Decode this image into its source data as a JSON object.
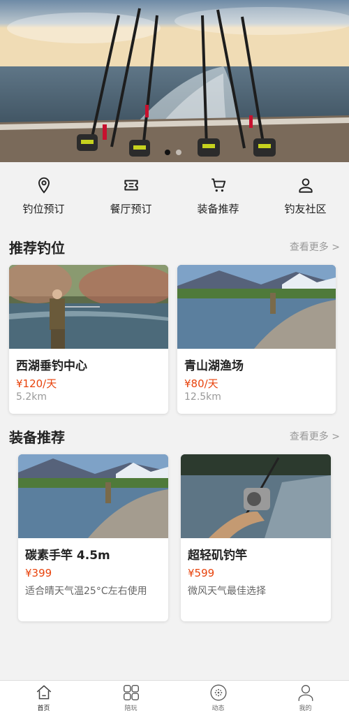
{
  "banner": {
    "image_alt": "fishing-boat-rods-photo",
    "slide_count": 2,
    "active_slide": 1
  },
  "quicknav": [
    {
      "label": "钓位预订",
      "icon": "location-pin-icon"
    },
    {
      "label": "餐厅预订",
      "icon": "ticket-icon"
    },
    {
      "label": "装备推荐",
      "icon": "cart-icon"
    },
    {
      "label": "钓友社区",
      "icon": "user-icon"
    }
  ],
  "spots": {
    "title": "推荐钓位",
    "more": "查看更多 >",
    "items": [
      {
        "name": "西湖垂钓中心",
        "price": "¥120/天",
        "distance": "5.2km"
      },
      {
        "name": "青山湖渔场",
        "price": "¥80/天",
        "distance": "12.5km"
      }
    ]
  },
  "gear": {
    "title": "装备推荐",
    "more": "查看更多 >",
    "items": [
      {
        "name": "碳素手竿 4.5m",
        "price": "¥399",
        "desc": "适合晴天气温25°C左右使用"
      },
      {
        "name": "超轻矶钓竿",
        "price": "¥599",
        "desc": "微风天气最佳选择"
      }
    ]
  },
  "tabs": [
    {
      "label": "首页",
      "icon": "home-icon",
      "active": true
    },
    {
      "label": "陪玩",
      "icon": "grid-icon",
      "active": false
    },
    {
      "label": "动态",
      "icon": "activity-icon",
      "active": false
    },
    {
      "label": "我的",
      "icon": "profile-icon",
      "active": false
    }
  ],
  "colors": {
    "accent_price": "#e8430c",
    "background": "#f2f2f2"
  }
}
